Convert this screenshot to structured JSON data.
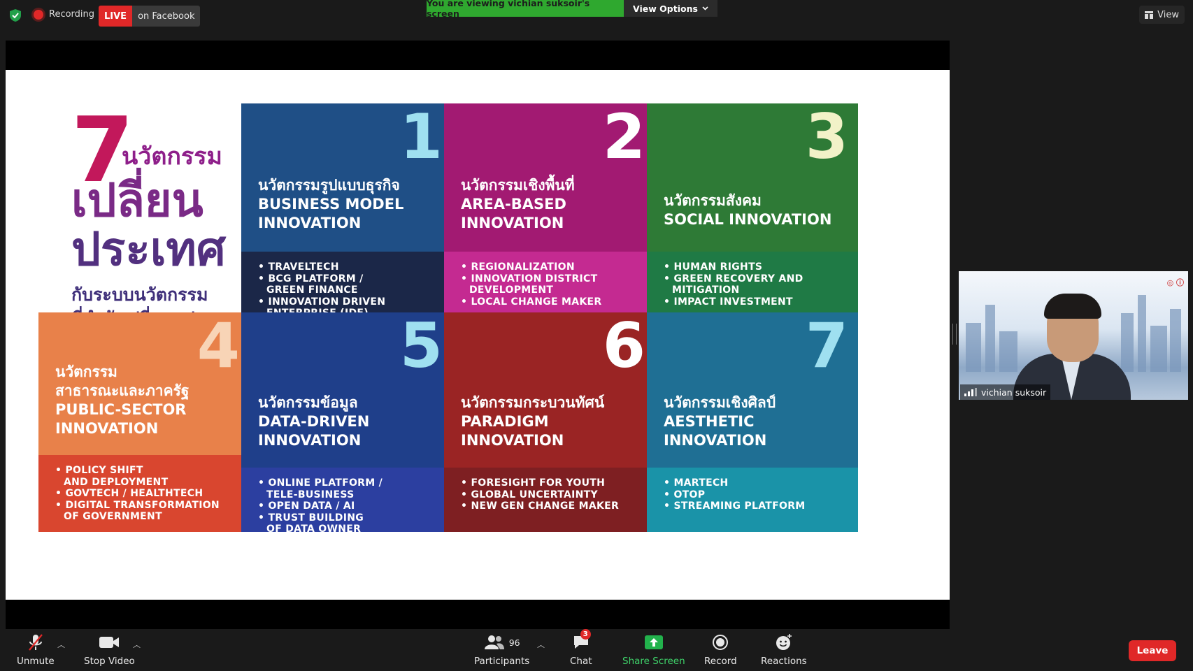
{
  "topbar": {
    "recording_label": "Recording",
    "live_tag": "LIVE",
    "live_platform": "on Facebook",
    "viewing_banner": "You are viewing vichian suksoir's screen",
    "view_options_label": "View Options",
    "view_label": "View"
  },
  "slide": {
    "title_number": "7",
    "title_line1": "นวัตกรรม",
    "title_line2": "เปลี่ยน",
    "title_line3": "ประเทศ",
    "subtitle_line1": "กับระบบนวัตกรรม",
    "subtitle_line2": "ที่กำลังเปลี่ยนแปลง",
    "cards": [
      {
        "number": "1",
        "thai": "นวัตกรรมรูปแบบธุรกิจ",
        "en1": "BUSINESS MODEL",
        "en2": "INNOVATION",
        "bullets": [
          [
            "TRAVELTECH"
          ],
          [
            "BCG PLATFORM /",
            "GREEN FINANCE"
          ],
          [
            "INNOVATION DRIVEN",
            "ENTERPRISE (IDE)"
          ]
        ],
        "color_top": "#1f4f86",
        "color_bottom": "#1b2748"
      },
      {
        "number": "2",
        "thai": "นวัตกรรมเชิงพื้นที่",
        "en1": "AREA-BASED",
        "en2": "INNOVATION",
        "bullets": [
          [
            "REGIONALIZATION"
          ],
          [
            "INNOVATION DISTRICT",
            "DEVELOPMENT"
          ],
          [
            "LOCAL CHANGE MAKER"
          ]
        ],
        "color_top": "#a21a72",
        "color_bottom": "#c42a91"
      },
      {
        "number": "3",
        "thai": "นวัตกรรมสังคม",
        "en1": "SOCIAL INNOVATION",
        "en2": "",
        "bullets": [
          [
            "HUMAN RIGHTS"
          ],
          [
            "GREEN RECOVERY AND",
            "MITIGATION"
          ],
          [
            "IMPACT INVESTMENT"
          ]
        ],
        "color_top": "#2e7a36",
        "color_bottom": "#1f7a45"
      },
      {
        "number": "4",
        "thai": "นวัตกรรม",
        "thai2": "สาธารณะและภาครัฐ",
        "en1": "PUBLIC-SECTOR",
        "en2": "INNOVATION",
        "bullets": [
          [
            "POLICY SHIFT",
            "AND DEPLOYMENT"
          ],
          [
            "GOVTECH / HEALTHTECH"
          ],
          [
            "DIGITAL TRANSFORMATION",
            "OF GOVERNMENT"
          ]
        ],
        "color_top": "#e8814a",
        "color_bottom": "#d9462f"
      },
      {
        "number": "5",
        "thai": "นวัตกรรมข้อมูล",
        "en1": "DATA-DRIVEN",
        "en2": "INNOVATION",
        "bullets": [
          [
            "ONLINE PLATFORM /",
            "TELE-BUSINESS"
          ],
          [
            "OPEN DATA / AI"
          ],
          [
            "TRUST BUILDING",
            "OF DATA OWNER"
          ]
        ],
        "color_top": "#1f3f8a",
        "color_bottom": "#2c3fa0"
      },
      {
        "number": "6",
        "thai": "นวัตกรรมกระบวนทัศน์",
        "en1": "PARADIGM",
        "en2": "INNOVATION",
        "bullets": [
          [
            "FORESIGHT FOR YOUTH"
          ],
          [
            "GLOBAL UNCERTAINTY"
          ],
          [
            "NEW GEN CHANGE MAKER"
          ]
        ],
        "color_top": "#9a2424",
        "color_bottom": "#7e1f22"
      },
      {
        "number": "7",
        "thai": "นวัตกรรมเชิงศิลป์",
        "en1": "AESTHETIC",
        "en2": "INNOVATION",
        "bullets": [
          [
            "MARTECH"
          ],
          [
            "OTOP"
          ],
          [
            "STREAMING PLATFORM"
          ]
        ],
        "color_top": "#1f6f94",
        "color_bottom": "#1a93a8"
      }
    ]
  },
  "participant_video": {
    "name": "vichian suksoir"
  },
  "toolbar": {
    "unmute": "Unmute",
    "stop_video": "Stop Video",
    "participants": "Participants",
    "participants_count": "96",
    "chat": "Chat",
    "chat_badge": "3",
    "share_screen": "Share Screen",
    "record": "Record",
    "reactions": "Reactions",
    "leave": "Leave"
  }
}
